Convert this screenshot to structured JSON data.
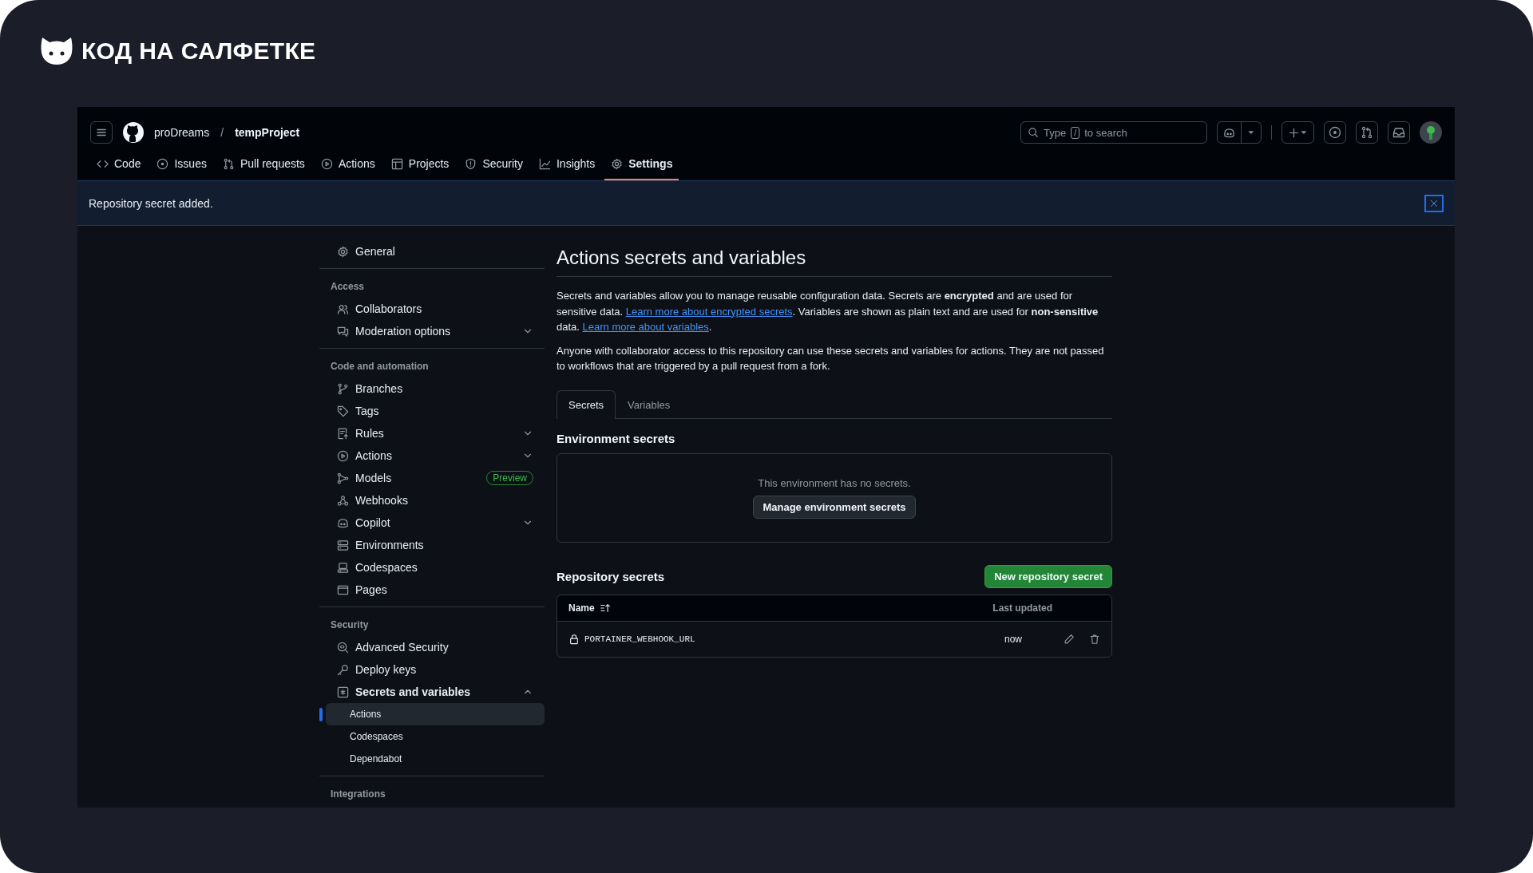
{
  "brand": {
    "title": "КОД НА САЛФЕТКЕ"
  },
  "header": {
    "owner": "proDreams",
    "separator": "/",
    "repo": "tempProject",
    "search": {
      "before": "Type",
      "key": "/",
      "after": "to search"
    }
  },
  "nav_tabs": [
    {
      "label": "Code",
      "kind": "code",
      "selected": false
    },
    {
      "label": "Issues",
      "kind": "issue",
      "selected": false
    },
    {
      "label": "Pull requests",
      "kind": "pr",
      "selected": false
    },
    {
      "label": "Actions",
      "kind": "play",
      "selected": false
    },
    {
      "label": "Projects",
      "kind": "table",
      "selected": false
    },
    {
      "label": "Security",
      "kind": "shield",
      "selected": false
    },
    {
      "label": "Insights",
      "kind": "graph",
      "selected": false
    },
    {
      "label": "Settings",
      "kind": "gear",
      "selected": true
    }
  ],
  "flash": {
    "message": "Repository secret added."
  },
  "sidebar": {
    "groups": [
      {
        "items": [
          {
            "label": "General",
            "kind": "gear",
            "selected": false
          }
        ]
      },
      {
        "header": "Access",
        "items": [
          {
            "label": "Collaborators",
            "kind": "people",
            "selected": false
          },
          {
            "label": "Moderation options",
            "kind": "comment",
            "selected": false,
            "expanded": false
          }
        ]
      },
      {
        "header": "Code and automation",
        "items": [
          {
            "label": "Branches",
            "kind": "branch",
            "selected": false
          },
          {
            "label": "Tags",
            "kind": "tag",
            "selected": false
          },
          {
            "label": "Rules",
            "kind": "rules",
            "selected": false,
            "expanded": false
          },
          {
            "label": "Actions",
            "kind": "play",
            "selected": false,
            "expanded": false
          },
          {
            "label": "Models",
            "kind": "models",
            "selected": false,
            "badge": "Preview"
          },
          {
            "label": "Webhooks",
            "kind": "webhook",
            "selected": false
          },
          {
            "label": "Copilot",
            "kind": "copilot",
            "selected": false,
            "expanded": false
          },
          {
            "label": "Environments",
            "kind": "server",
            "selected": false
          },
          {
            "label": "Codespaces",
            "kind": "codespaces",
            "selected": false
          },
          {
            "label": "Pages",
            "kind": "browser",
            "selected": false
          }
        ]
      },
      {
        "header": "Security",
        "items": [
          {
            "label": "Advanced Security",
            "kind": "codescan",
            "selected": false
          },
          {
            "label": "Deploy keys",
            "kind": "key",
            "selected": false
          },
          {
            "label": "Secrets and variables",
            "kind": "asterisk",
            "selected": false,
            "expanded": true,
            "children": [
              {
                "label": "Actions",
                "selected": true
              },
              {
                "label": "Codespaces",
                "selected": false
              },
              {
                "label": "Dependabot",
                "selected": false
              }
            ]
          }
        ]
      },
      {
        "header": "Integrations"
      }
    ]
  },
  "main": {
    "title": "Actions secrets and variables",
    "paragraphs": [
      [
        {
          "kind": "text",
          "text": "Secrets and variables allow you to manage reusable configuration data. Secrets are **encrypted** and are used for sensitive data. "
        },
        {
          "kind": "link",
          "text": "Learn more about encrypted secrets"
        },
        {
          "kind": "text",
          "text": ". Variables are shown as plain text and are used for **non-sensitive** data. "
        },
        {
          "kind": "link",
          "text": "Learn more about variables"
        },
        {
          "kind": "text",
          "text": "."
        }
      ],
      [
        {
          "kind": "text",
          "text": "Anyone with collaborator access to this repository can use these secrets and variables for actions. They are not passed to workflows that are triggered by a pull request from a fork."
        }
      ]
    ],
    "tabs": [
      {
        "label": "Secrets",
        "selected": true
      },
      {
        "label": "Variables",
        "selected": false
      }
    ],
    "environment_secrets": {
      "title": "Environment secrets",
      "empty_message": "This environment has no secrets.",
      "button": "Manage environment secrets"
    },
    "repository_secrets": {
      "title": "Repository secrets",
      "button": "New repository secret",
      "columns": [
        "Name",
        "Last updated"
      ],
      "rows": [
        {
          "name": "PORTAINER_WEBHOOK_URL",
          "updated": "now"
        }
      ]
    }
  }
}
